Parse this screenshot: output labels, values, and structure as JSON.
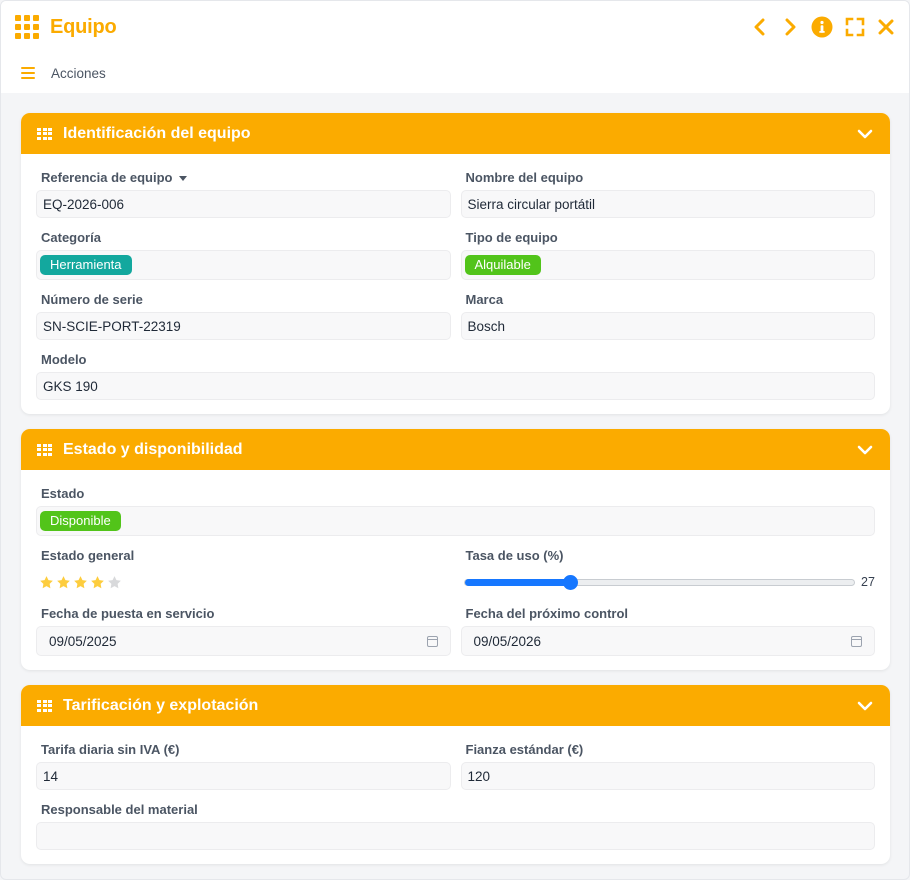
{
  "window": {
    "title": "Equipo"
  },
  "menu": {
    "actions_label": "Acciones"
  },
  "colors": {
    "accent": "#fbab00",
    "teal": "#13a89e",
    "green": "#52c41a",
    "slider": "#1677ff",
    "star_on": "#fdcd3e",
    "star_off": "#d8d9db"
  },
  "icons": [
    "grid-icon",
    "chevron-left-icon",
    "chevron-right-icon",
    "info-icon",
    "fullscreen-icon",
    "close-icon",
    "hamburger-icon",
    "table-icon",
    "chevron-down-icon",
    "calendar-icon",
    "star-icon"
  ],
  "sections": {
    "identification": {
      "title": "Identificación del equipo",
      "ref_label": "Referencia de equipo",
      "ref_value": "EQ-2026-006",
      "name_label": "Nombre del equipo",
      "name_value": "Sierra circular portátil",
      "category_label": "Categoría",
      "category_value": "Herramienta",
      "type_label": "Tipo de equipo",
      "type_value": "Alquilable",
      "serial_label": "Número de serie",
      "serial_value": "SN-SCIE-PORT-22319",
      "brand_label": "Marca",
      "brand_value": "Bosch",
      "model_label": "Modelo",
      "model_value": "GKS 190"
    },
    "status": {
      "title": "Estado y disponibilidad",
      "state_label": "Estado",
      "state_value": "Disponible",
      "general_label": "Estado general",
      "rating": 4,
      "rating_max": 5,
      "usage_label": "Tasa de uso (%)",
      "usage_value": 27,
      "usage_display": "27",
      "start_label": "Fecha de puesta en servicio",
      "start_value": "09/05/2025",
      "next_label": "Fecha del próximo control",
      "next_value": "09/05/2026"
    },
    "pricing": {
      "title": "Tarificación y explotación",
      "daily_label": "Tarifa diaria sin IVA (€)",
      "daily_value": "14",
      "deposit_label": "Fianza estándar (€)",
      "deposit_value": "120",
      "manager_label": "Responsable del material",
      "manager_value": ""
    }
  }
}
